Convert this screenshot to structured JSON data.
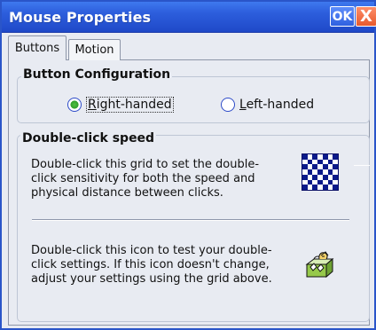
{
  "window": {
    "title": "Mouse Properties",
    "ok_label": "OK",
    "close_label": "X"
  },
  "tabs": [
    {
      "label": "Buttons",
      "active": true
    },
    {
      "label": "Motion",
      "active": false
    }
  ],
  "button_configuration": {
    "title": "Button Configuration",
    "right_handed_label": "Right-handed",
    "left_handed_label": "Left-handed",
    "selected": "right"
  },
  "double_click": {
    "title": "Double-click speed",
    "grid_text": "Double-click this grid to set the double-\nclick sensitivity for both the speed and\nphysical distance between clicks.",
    "test_text": "Double-click this icon to test your double-\nclick settings. If this icon doesn't change,\nadjust your settings using the grid above."
  },
  "icons": {
    "checker_grid": "checkerboard-grid-icon",
    "test_icon": "jack-in-the-box-icon"
  },
  "colors": {
    "titlebar": "#2d5fdd",
    "window_border": "#2a55c9",
    "panel_bg": "#e8ebf2",
    "group_border": "#bec6d5",
    "checker_dark": "#0b1a8a"
  }
}
